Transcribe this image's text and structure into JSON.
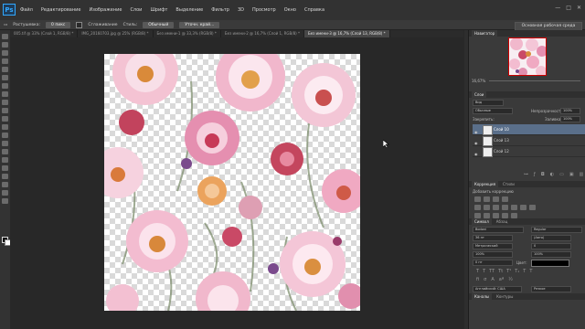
{
  "app": {
    "logo_text": "Ps"
  },
  "menu": [
    "Файл",
    "Редактирование",
    "Изображение",
    "Слои",
    "Шрифт",
    "Выделение",
    "Фильтр",
    "3D",
    "Просмотр",
    "Окно",
    "Справка"
  ],
  "window_controls": [
    "—",
    "□",
    "✕"
  ],
  "options_bar": {
    "refine_label": "Растушевка:",
    "refine_value": "0 пикс",
    "antialias_label": "Сглаживание",
    "style_label": "Стиль:",
    "style_value": "Обычный",
    "refine_edge_button": "Уточн. край..."
  },
  "workspace_button": "Основная рабочая среда",
  "tabs": [
    {
      "label": "005.tif @ 33% (Слой 1, RGB/8) *",
      "active": false
    },
    {
      "label": "IMG_20160703.jpg @ 25% (RGB/8) *",
      "active": false
    },
    {
      "label": "Без имени-1 @ 33,3% (RGB/8) *",
      "active": false
    },
    {
      "label": "Без имени-2 @ 16,7% (Слой 1, RGB/8) *",
      "active": false
    },
    {
      "label": "Без имени-3 @ 16,7% (Слой 13, RGB/8) *",
      "active": true
    }
  ],
  "navigator": {
    "title": "Навигатор",
    "zoom": "16,67%"
  },
  "layers": {
    "title": "Слои",
    "kind_label": "Вид",
    "blend_mode": "Обычные",
    "opacity_label": "Непрозрачность:",
    "opacity_value": "100%",
    "lock_label": "Закрепить:",
    "fill_label": "Заливка:",
    "fill_value": "100%",
    "rows": [
      {
        "name": "Слой 10",
        "selected": true
      },
      {
        "name": "Слой 13",
        "selected": false
      },
      {
        "name": "Слой 12",
        "selected": false
      }
    ]
  },
  "adjustments": {
    "tab1": "Коррекция",
    "tab2": "Стили",
    "header": "Добавить коррекцию"
  },
  "character": {
    "tab1": "Символ",
    "tab2": "Абзац",
    "font_family": "Bodoni",
    "font_style": "Regular",
    "size": "36 пт",
    "leading": "(Авто)",
    "kerning": "Метрический",
    "tracking": "0",
    "scale_v": "100%",
    "scale_h": "100%",
    "baseline": "0 пт",
    "color_label": "Цвет:",
    "language": "Английский: США",
    "aa": "Резкое"
  },
  "bottom_tabs": {
    "tab1": "Каналы",
    "tab2": "Контуры"
  }
}
